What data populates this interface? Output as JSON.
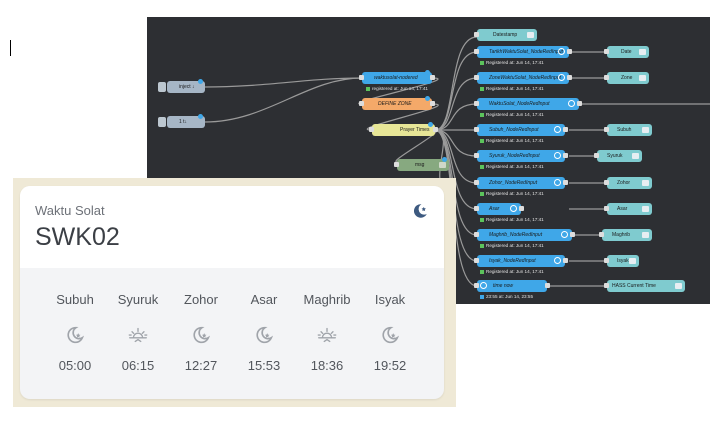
{
  "nodered": {
    "nodes": {
      "inject": "inject ↓",
      "one_t": "1 t↓",
      "waktu_nodered": "waktusolat-nodered",
      "define_zone": "DEFINE ZONE",
      "prayer_times": "Prayer Times",
      "msg": "msg",
      "datestamp": "Datestamp",
      "tarikh": "TarikhWaktuSolat_NodeRedInput",
      "date": "Date",
      "zone_input": "ZoneWaktuSolat_NodeRedInput",
      "zone": "Zone",
      "waktu_input": "WaktuSolat_NodeRedInput",
      "subuh_input": "Subuh_NodeRedInput",
      "subuh": "Subuh",
      "syuruk_input": "Syuruk_NodeRedInput",
      "syuruk": "Syuruk",
      "zohor_input": "Zohor_NodeRedInput",
      "zohor": "Zohor",
      "asar_input": "Asar",
      "asar": "Asar",
      "maghrib_input": "Maghrib_NodeRedInput",
      "maghrib": "Maghrib",
      "isyak_input": "Isyak_NodeRedInput",
      "isyak": "Isyak",
      "time_now": "time now",
      "hass_time": "HASS Current Time"
    },
    "status": {
      "registered": "Registered at: Jun 14, 17:41",
      "registered_lower": "registered at: Jun 14, 17:41",
      "time_now_status": "23:55 at: Jun 14, 23:55"
    },
    "colors": {
      "canvas": "#2d2f33",
      "wire": "#9a9a9a",
      "node_blue": "#3fa7e8",
      "node_teal": "#7fcbcf"
    }
  },
  "card": {
    "title": "Waktu Solat",
    "zone_id": "SWK02",
    "header_icon": "moon-star-icon",
    "prayers": [
      {
        "name": "Subuh",
        "icon": "moon-star-icon",
        "time": "05:00"
      },
      {
        "name": "Syuruk",
        "icon": "sunrise-icon",
        "time": "06:15"
      },
      {
        "name": "Zohor",
        "icon": "moon-star-icon",
        "time": "12:27"
      },
      {
        "name": "Asar",
        "icon": "moon-star-icon",
        "time": "15:53"
      },
      {
        "name": "Maghrib",
        "icon": "sunrise-icon",
        "time": "18:36"
      },
      {
        "name": "Isyak",
        "icon": "moon-star-icon",
        "time": "19:52"
      }
    ],
    "colors": {
      "accent": "#3d5a80",
      "text": "#52565c",
      "icon": "#a0a4aa",
      "frame": "#efe9d6"
    }
  }
}
